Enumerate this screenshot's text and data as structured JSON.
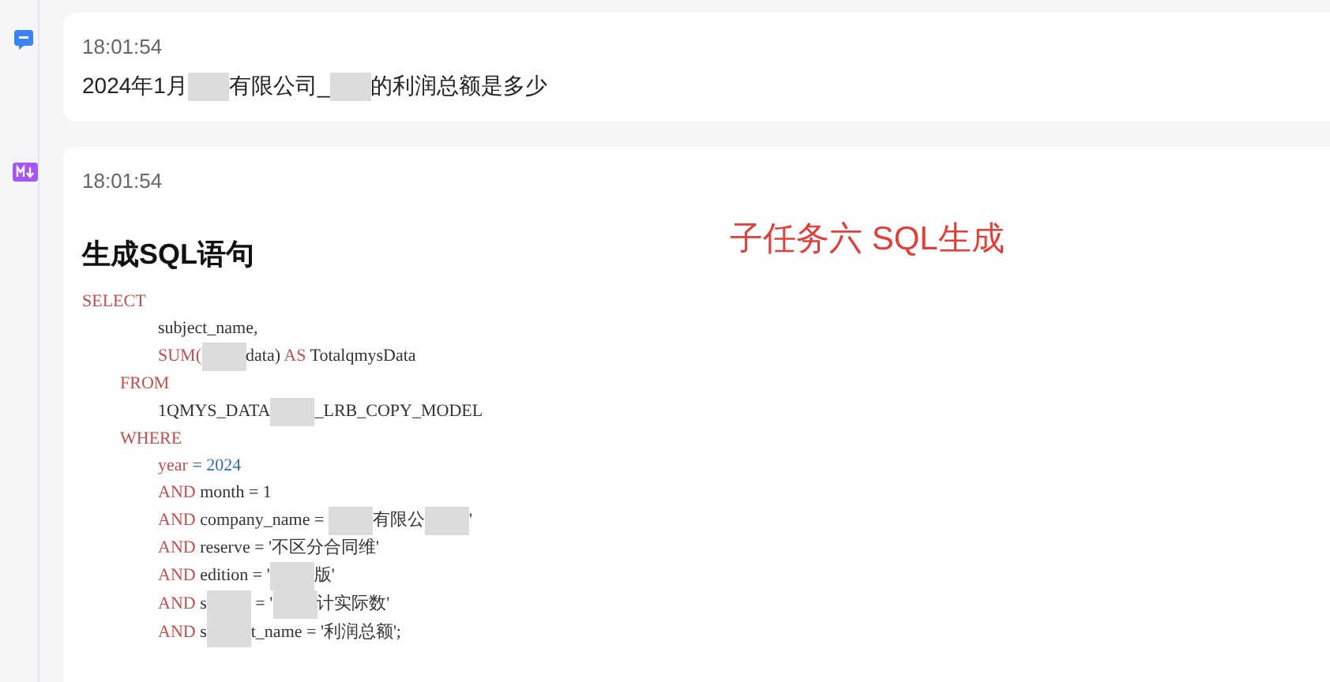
{
  "messages": [
    {
      "kind": "question",
      "time": "18:01:54",
      "parts": [
        {
          "kind": "text",
          "text": "2024年1月"
        },
        {
          "kind": "redacted"
        },
        {
          "kind": "text",
          "text": "有限公司_"
        },
        {
          "kind": "redacted"
        },
        {
          "kind": "text",
          "text": "的利润总额是多少"
        }
      ]
    },
    {
      "kind": "answer",
      "time": "18:01:54",
      "heading": "生成SQL语句",
      "note": "子任务六 SQL生成",
      "code": [
        {
          "kind": "statement",
          "tokens": [
            {
              "kind": "keyword",
              "text": "SELECT"
            }
          ]
        },
        {
          "kind": "item",
          "tokens": [
            {
              "kind": "plain",
              "text": "subject_name,"
            }
          ]
        },
        {
          "kind": "item",
          "tokens": [
            {
              "kind": "keyword",
              "text": "SUM("
            },
            {
              "kind": "redacted"
            },
            {
              "kind": "plain",
              "text": "data)"
            },
            {
              "kind": "keyword",
              "text": " AS"
            },
            {
              "kind": "plain",
              "text": " TotalqmysData"
            }
          ]
        },
        {
          "kind": "clause",
          "tokens": [
            {
              "kind": "keyword",
              "text": "FROM"
            }
          ]
        },
        {
          "kind": "item",
          "tokens": [
            {
              "kind": "plain",
              "text": "1QMYS_DATA"
            },
            {
              "kind": "redacted"
            },
            {
              "kind": "plain",
              "text": "_LRB_COPY_MODEL"
            }
          ]
        },
        {
          "kind": "clause",
          "tokens": [
            {
              "kind": "keyword",
              "text": "WHERE"
            }
          ]
        },
        {
          "kind": "item",
          "tokens": [
            {
              "kind": "keyword",
              "text": "year"
            },
            {
              "kind": "number",
              "text": " = 2024"
            }
          ]
        },
        {
          "kind": "item",
          "tokens": [
            {
              "kind": "keyword",
              "text": "AND"
            },
            {
              "kind": "plain",
              "text": " month = 1"
            }
          ]
        },
        {
          "kind": "item",
          "tokens": [
            {
              "kind": "keyword",
              "text": "AND"
            },
            {
              "kind": "plain",
              "text": " company_name = "
            },
            {
              "kind": "redacted"
            },
            {
              "kind": "plain",
              "text": "有限公"
            },
            {
              "kind": "redacted"
            },
            {
              "kind": "plain",
              "text": "'"
            }
          ]
        },
        {
          "kind": "item",
          "tokens": [
            {
              "kind": "keyword",
              "text": "AND"
            },
            {
              "kind": "plain",
              "text": " reserve = '不区分合同维'"
            }
          ]
        },
        {
          "kind": "item",
          "tokens": [
            {
              "kind": "keyword",
              "text": "AND"
            },
            {
              "kind": "plain",
              "text": " edition = '"
            },
            {
              "kind": "redacted"
            },
            {
              "kind": "plain",
              "text": "版'"
            }
          ]
        },
        {
          "kind": "item",
          "tokens": [
            {
              "kind": "keyword",
              "text": "AND"
            },
            {
              "kind": "plain",
              "text": " s"
            },
            {
              "kind": "redacted"
            },
            {
              "kind": "plain",
              "text": " = '"
            },
            {
              "kind": "redacted"
            },
            {
              "kind": "plain",
              "text": "计实际数'"
            }
          ]
        },
        {
          "kind": "item",
          "tokens": [
            {
              "kind": "keyword",
              "text": "AND"
            },
            {
              "kind": "plain",
              "text": " s"
            },
            {
              "kind": "redacted"
            },
            {
              "kind": "plain",
              "text": "t_name = '利润总额';"
            }
          ]
        }
      ]
    }
  ]
}
